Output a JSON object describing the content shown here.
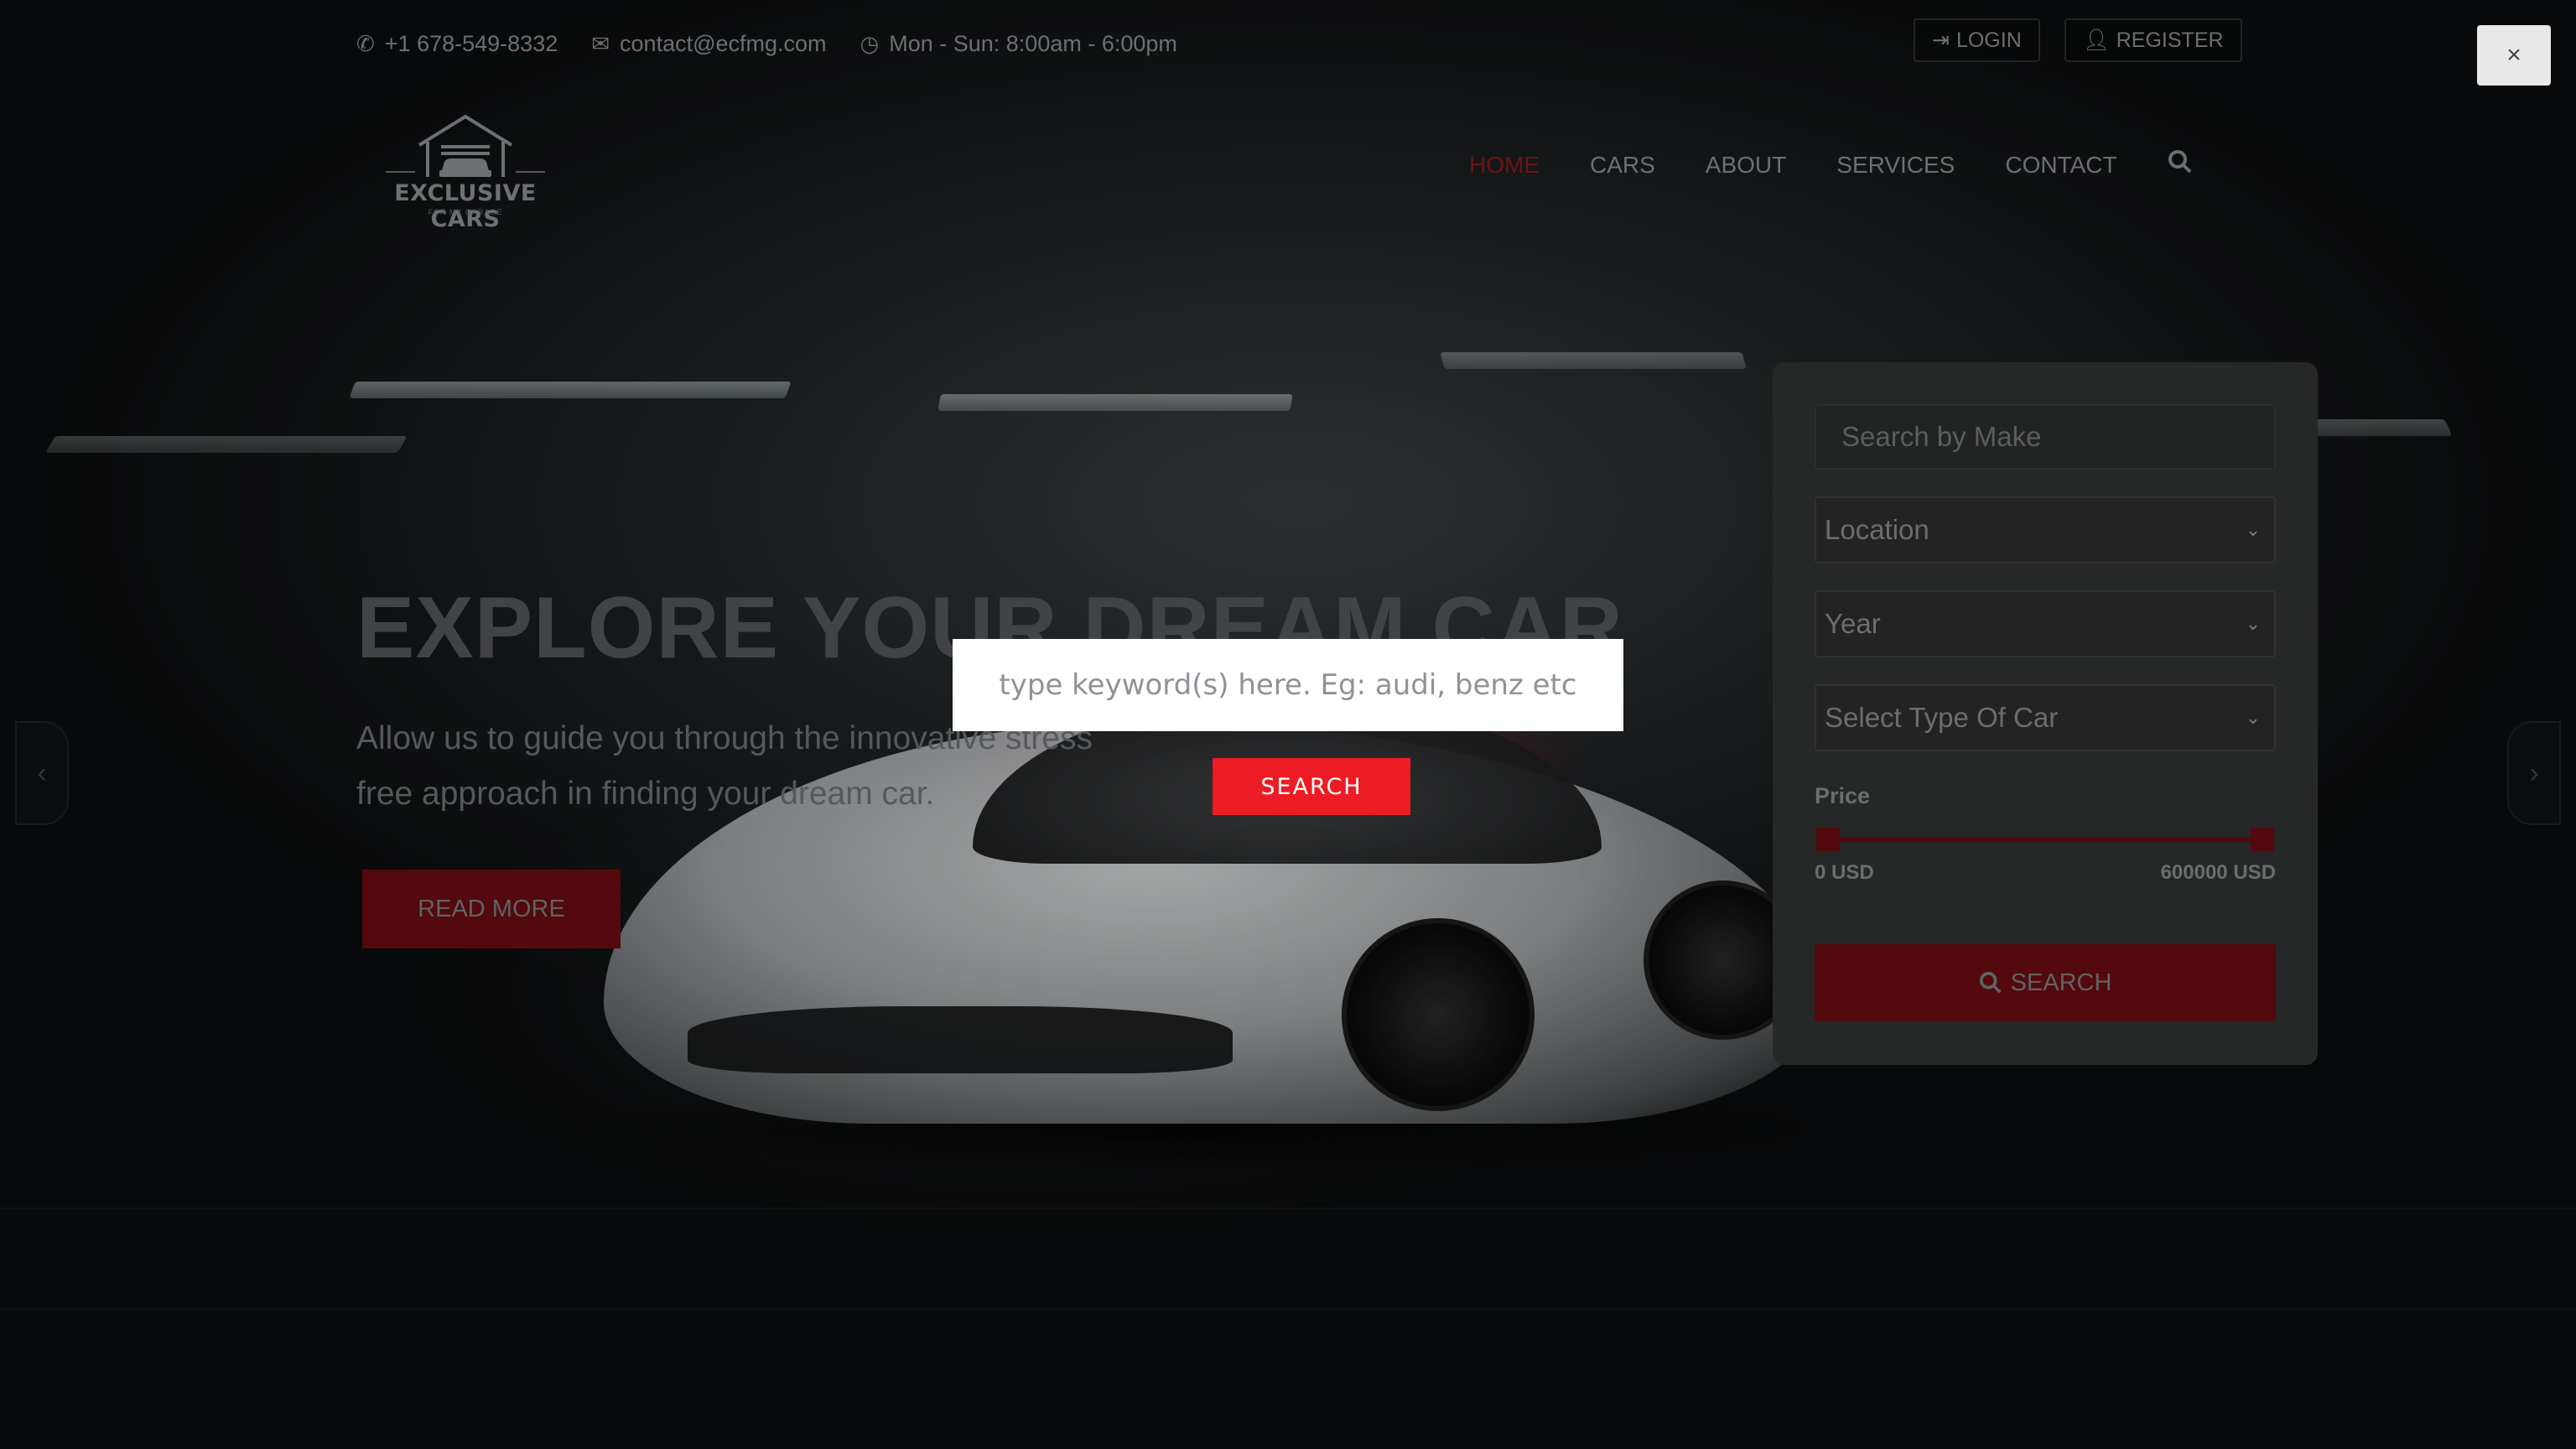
{
  "topbar": {
    "phone": "+1 678-549-8332",
    "email": "contact@ecfmg.com",
    "hours": "Mon - Sun: 8:00am - 6:00pm"
  },
  "auth": {
    "login": "LOGIN",
    "register": "REGISTER"
  },
  "logo": {
    "title": "EXCLUSIVE CARS",
    "subtitle": "FOR MY GARAGE"
  },
  "nav": {
    "items": [
      "HOME",
      "CARS",
      "ABOUT",
      "SERVICES",
      "CONTACT"
    ],
    "active": "HOME"
  },
  "hero": {
    "title": "EXPLORE YOUR DREAM CAR",
    "subtitle": "Allow us to guide you through the innovative stress free approach in finding your dream car.",
    "button": "READ MORE"
  },
  "search_panel": {
    "make_placeholder": "Search by Make",
    "location": "Location",
    "year": "Year",
    "car_type": "Select Type Of Car",
    "price_label": "Price",
    "price_min": "0 USD",
    "price_max": "600000 USD",
    "price_range_fraction": [
      0.0,
      1.0
    ],
    "search_label": "SEARCH"
  },
  "modal": {
    "placeholder": "type keyword(s) here. Eg: audi, benz etc",
    "search_label": "SEARCH",
    "close_glyph": "×"
  },
  "icons": {
    "phone": "phone-icon",
    "email": "envelope-icon",
    "clock": "clock-icon",
    "login": "sign-in-icon",
    "register": "user-icon",
    "nav_search": "search-icon",
    "panel_search": "search-icon",
    "arrow_left": "chevron-left-icon",
    "arrow_right": "chevron-right-icon",
    "close": "close-icon"
  },
  "colors": {
    "accent": "#ed1c24",
    "accent_dim": "#6b0c11"
  }
}
